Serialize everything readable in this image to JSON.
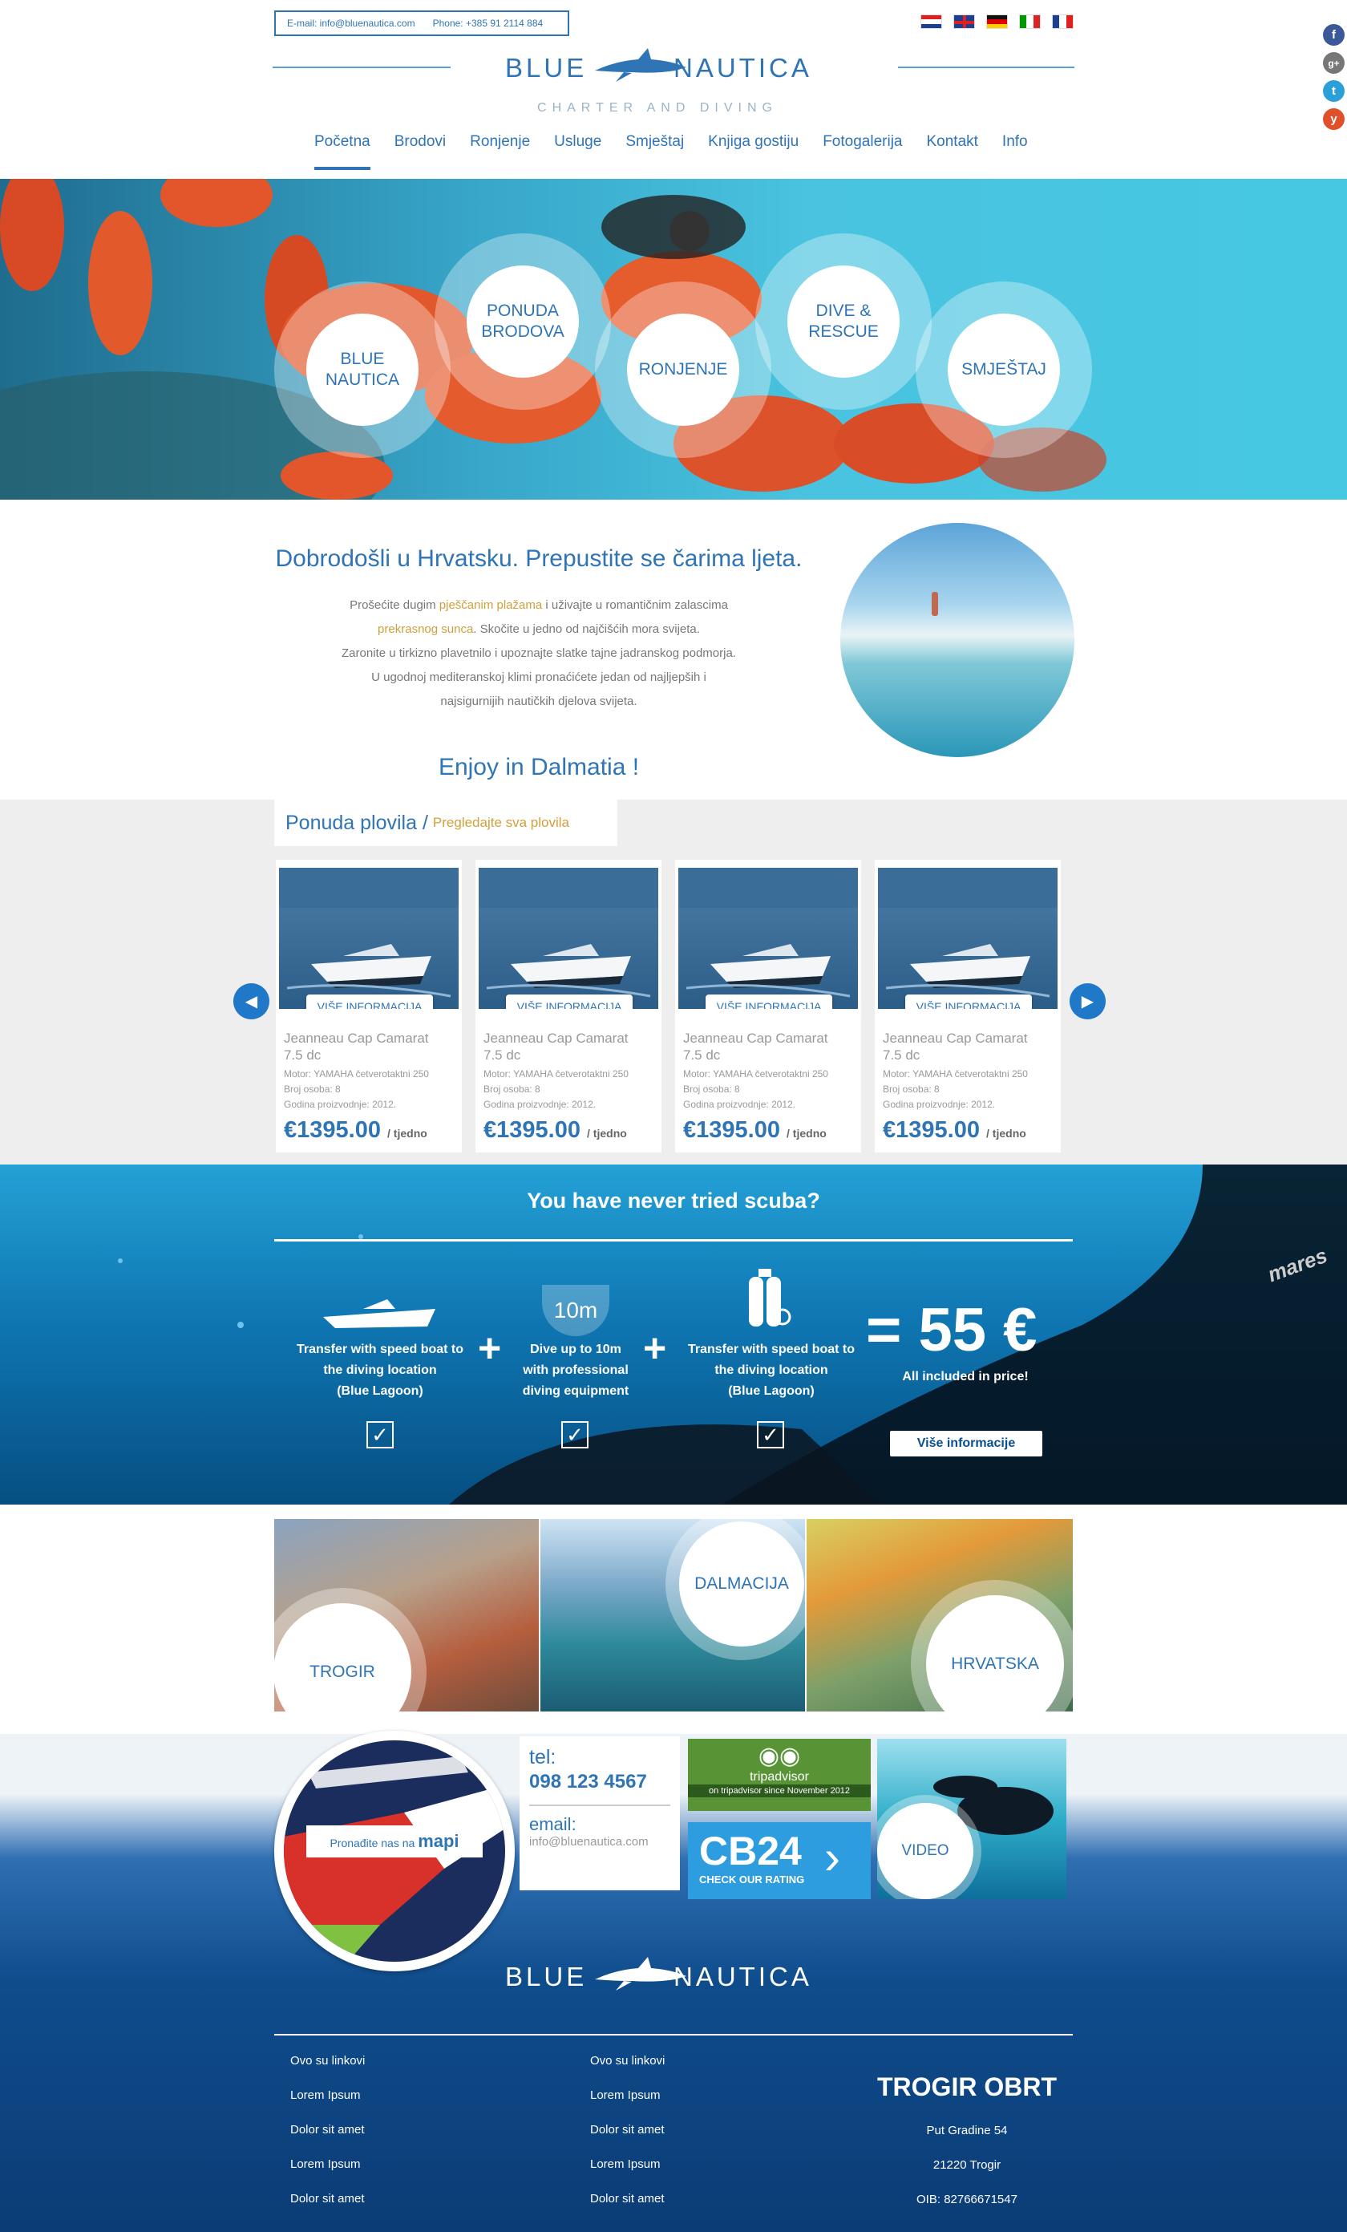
{
  "header": {
    "email": "E-mail: info@bluenautica.com",
    "phone": "Phone: +385 91 2114 884",
    "logo_left": "BLUE",
    "logo_right": "NAUTICA",
    "tagline": "CHARTER AND DIVING",
    "languages": [
      "hr",
      "en",
      "de",
      "it",
      "fr"
    ],
    "social": [
      "f",
      "g+",
      "t",
      "y"
    ],
    "nav": [
      "Početna",
      "Brodovi",
      "Ronjenje",
      "Usluge",
      "Smještaj",
      "Knjiga gostiju",
      "Fotogalerija",
      "Kontakt",
      "Info"
    ]
  },
  "hero": {
    "circles": [
      {
        "l1": "BLUE",
        "l2": "NAUTICA"
      },
      {
        "l1": "PONUDA",
        "l2": "BRODOVA"
      },
      {
        "l1": "RONJENJE",
        "l2": ""
      },
      {
        "l1": "DIVE &",
        "l2": "RESCUE"
      },
      {
        "l1": "SMJEŠTAJ",
        "l2": ""
      }
    ]
  },
  "welcome": {
    "title": "Dobrodošli u Hrvatsku. Prepustite se čarima ljeta.",
    "p1a": "Prošećite dugim ",
    "p1b": "pješčanim plažama",
    "p1c": " i uživajte u romantičnim zalascima",
    "p2a": "prekrasnog sunca",
    "p2b": ". Skočite u jedno od najčišćih mora svijeta.",
    "p3": "Zaronite u tirkizno plavetnilo i upoznajte slatke tajne jadranskog podmorja.",
    "p4": "U ugodnoj mediteranskoj klimi pronaćićete jedan od najljepših i",
    "p5": "najsigurnijih nautičkih djelova svijeta.",
    "enjoy": "Enjoy in Dalmatia !"
  },
  "boats": {
    "section_title": "Ponuda plovila /",
    "view_all": "Pregledajte sva plovila",
    "more_label": "VIŠE INFORMACIJA",
    "items": [
      {
        "name": "Jeanneau Cap Camarat",
        "model": "7.5 dc",
        "motor": "Motor: YAMAHA četverotaktni 250",
        "persons": "Broj osoba: 8",
        "year": "Godina proizvodnje: 2012.",
        "price": "€1395.00",
        "period": "/ tjedno"
      },
      {
        "name": "Jeanneau Cap Camarat",
        "model": "7.5 dc",
        "motor": "Motor: YAMAHA četverotaktni 250",
        "persons": "Broj osoba: 8",
        "year": "Godina proizvodnje: 2012.",
        "price": "€1395.00",
        "period": "/ tjedno"
      },
      {
        "name": "Jeanneau Cap Camarat",
        "model": "7.5 dc",
        "motor": "Motor: YAMAHA četverotaktni 250",
        "persons": "Broj osoba: 8",
        "year": "Godina proizvodnje: 2012.",
        "price": "€1395.00",
        "period": "/ tjedno"
      },
      {
        "name": "Jeanneau Cap Camarat",
        "model": "7.5 dc",
        "motor": "Motor: YAMAHA četverotaktni 250",
        "persons": "Broj osoba: 8",
        "year": "Godina proizvodnje: 2012.",
        "price": "€1395.00",
        "period": "/ tjedno"
      }
    ]
  },
  "scuba": {
    "title": "You have never tried scuba?",
    "depth": "10m",
    "step1": [
      "Transfer with speed boat to",
      "the diving location",
      "(Blue Lagoon)"
    ],
    "step2": [
      "Dive up to 10m",
      "with professional",
      "diving equipment"
    ],
    "step3": [
      "Transfer with speed boat to",
      "the diving location",
      "(Blue Lagoon)"
    ],
    "price": "= 55 €",
    "price_note": "All included in price!",
    "button": "Više informacije",
    "brand": "mares"
  },
  "locations": [
    "TROGIR",
    "DALMACIJA",
    "HRVATSKA"
  ],
  "contact": {
    "map_text": "Pronađite nas na",
    "map_bold": "mapi",
    "tel_label": "tel:",
    "tel": "098 123 4567",
    "email_label": "email:",
    "email": "info@bluenautica.com",
    "tripadvisor": "tripadvisor",
    "tripadvisor_note": "on tripadvisor since November 2012",
    "cb24": "CB24",
    "cb24_note": "CHECK OUR RATING",
    "video": "VIDEO"
  },
  "footer": {
    "col1": [
      "Ovo su linkovi",
      "Lorem Ipsum",
      "Dolor sit amet",
      "Lorem Ipsum",
      "Dolor sit amet"
    ],
    "col2": [
      "Ovo su linkovi",
      "Lorem Ipsum",
      "Dolor sit amet",
      "Lorem Ipsum",
      "Dolor sit amet"
    ],
    "company": "TROGIR OBRT",
    "address": "Put Gradine 54",
    "city": "21220 Trogir",
    "oib": "OIB: 82766671547"
  },
  "colors": {
    "brand": "#2f74b5",
    "gold": "#d1a03b",
    "button": "#1f78c8"
  }
}
